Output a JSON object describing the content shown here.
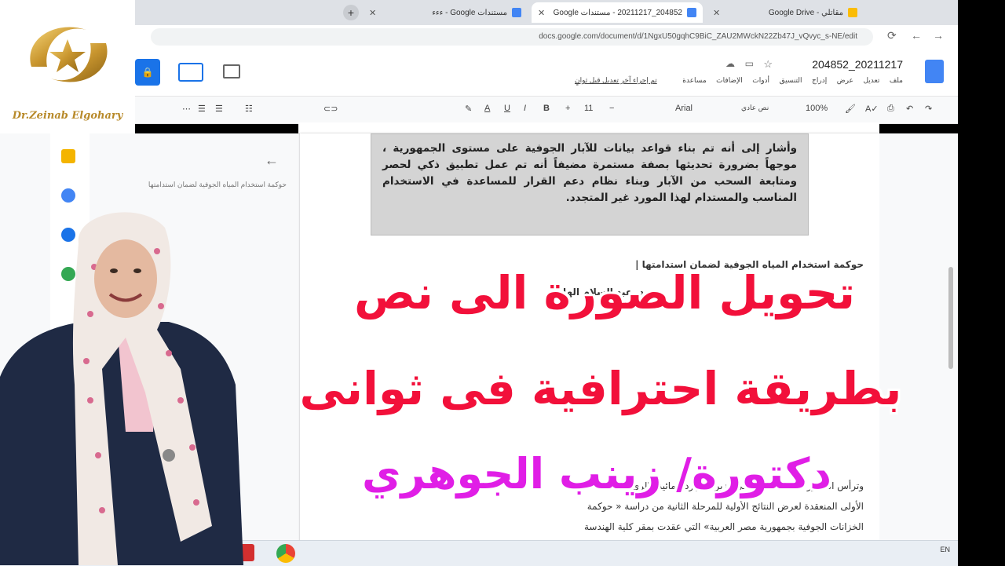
{
  "logo": {
    "text": "Dr.Zeinab Elgohary"
  },
  "browser": {
    "tabs": [
      {
        "label": "مستندات Google - ءءء"
      },
      {
        "label": "204852_20211217 - مستندات Google"
      },
      {
        "label": "مقاتلي - Google Drive"
      }
    ],
    "url": "docs.google.com/document/d/1NgxU50gqhC9BiC_ZAU2MWckN22Zb47J_vQvyc_s-NE/edit"
  },
  "docs": {
    "title": "204852_20211217",
    "menu": [
      "ملف",
      "تعديل",
      "عرض",
      "إدراج",
      "التنسيق",
      "أدوات",
      "الإضافات",
      "مساعدة",
      "تم إجراء آخر تعديل قبل ثوانٍ"
    ],
    "toolbar": {
      "zoom": "100%",
      "style": "نص عادي",
      "font": "Arial",
      "size": "11"
    },
    "outline_item": "حوكمة استخدام المياه الجوفية لضمان استدامتها",
    "scanned_text": "وأشار إلى أنه تم بناء قواعد بيانات للآبار الجوفية على مستوى الجمهورية ، موجهاً بضرورة تحديثها بصفة مستمرة مضيفاً أنه تم عمل تطبيق ذكي لحصر ومتابعة السحب من الآبار وبناء نظام دعم القرار للمساعدة في الاستخدام المناسب والمستدام لهذا المورد غير المتجدد.",
    "body_lines": [
      "حوكمة استخدام المياه الجوفية لضمان استدامتها |",
      "د. عبد السلام الهادي",
      "وترأس الدكتور محمد عبد العاطي وزير الموارد المائية والري الجلسة",
      "الأولى المنعقدة لعرض النتائج الأولية للمرحلة الثانية من دراسة « حوكمة",
      "الخزانات الجوفية بجمهورية مصر العربية» التي عقدت بمقر كلية الهندسة"
    ]
  },
  "overlay": {
    "line1": "تحويل الصورة الى نص",
    "line2": "بطريقة احترافية فى ثوانى",
    "line3": "دكتورة/ زينب الجوهري",
    "colors": {
      "red": "#f2103a",
      "magenta": "#e01ee6"
    }
  },
  "taskbar": {
    "language": "EN"
  }
}
